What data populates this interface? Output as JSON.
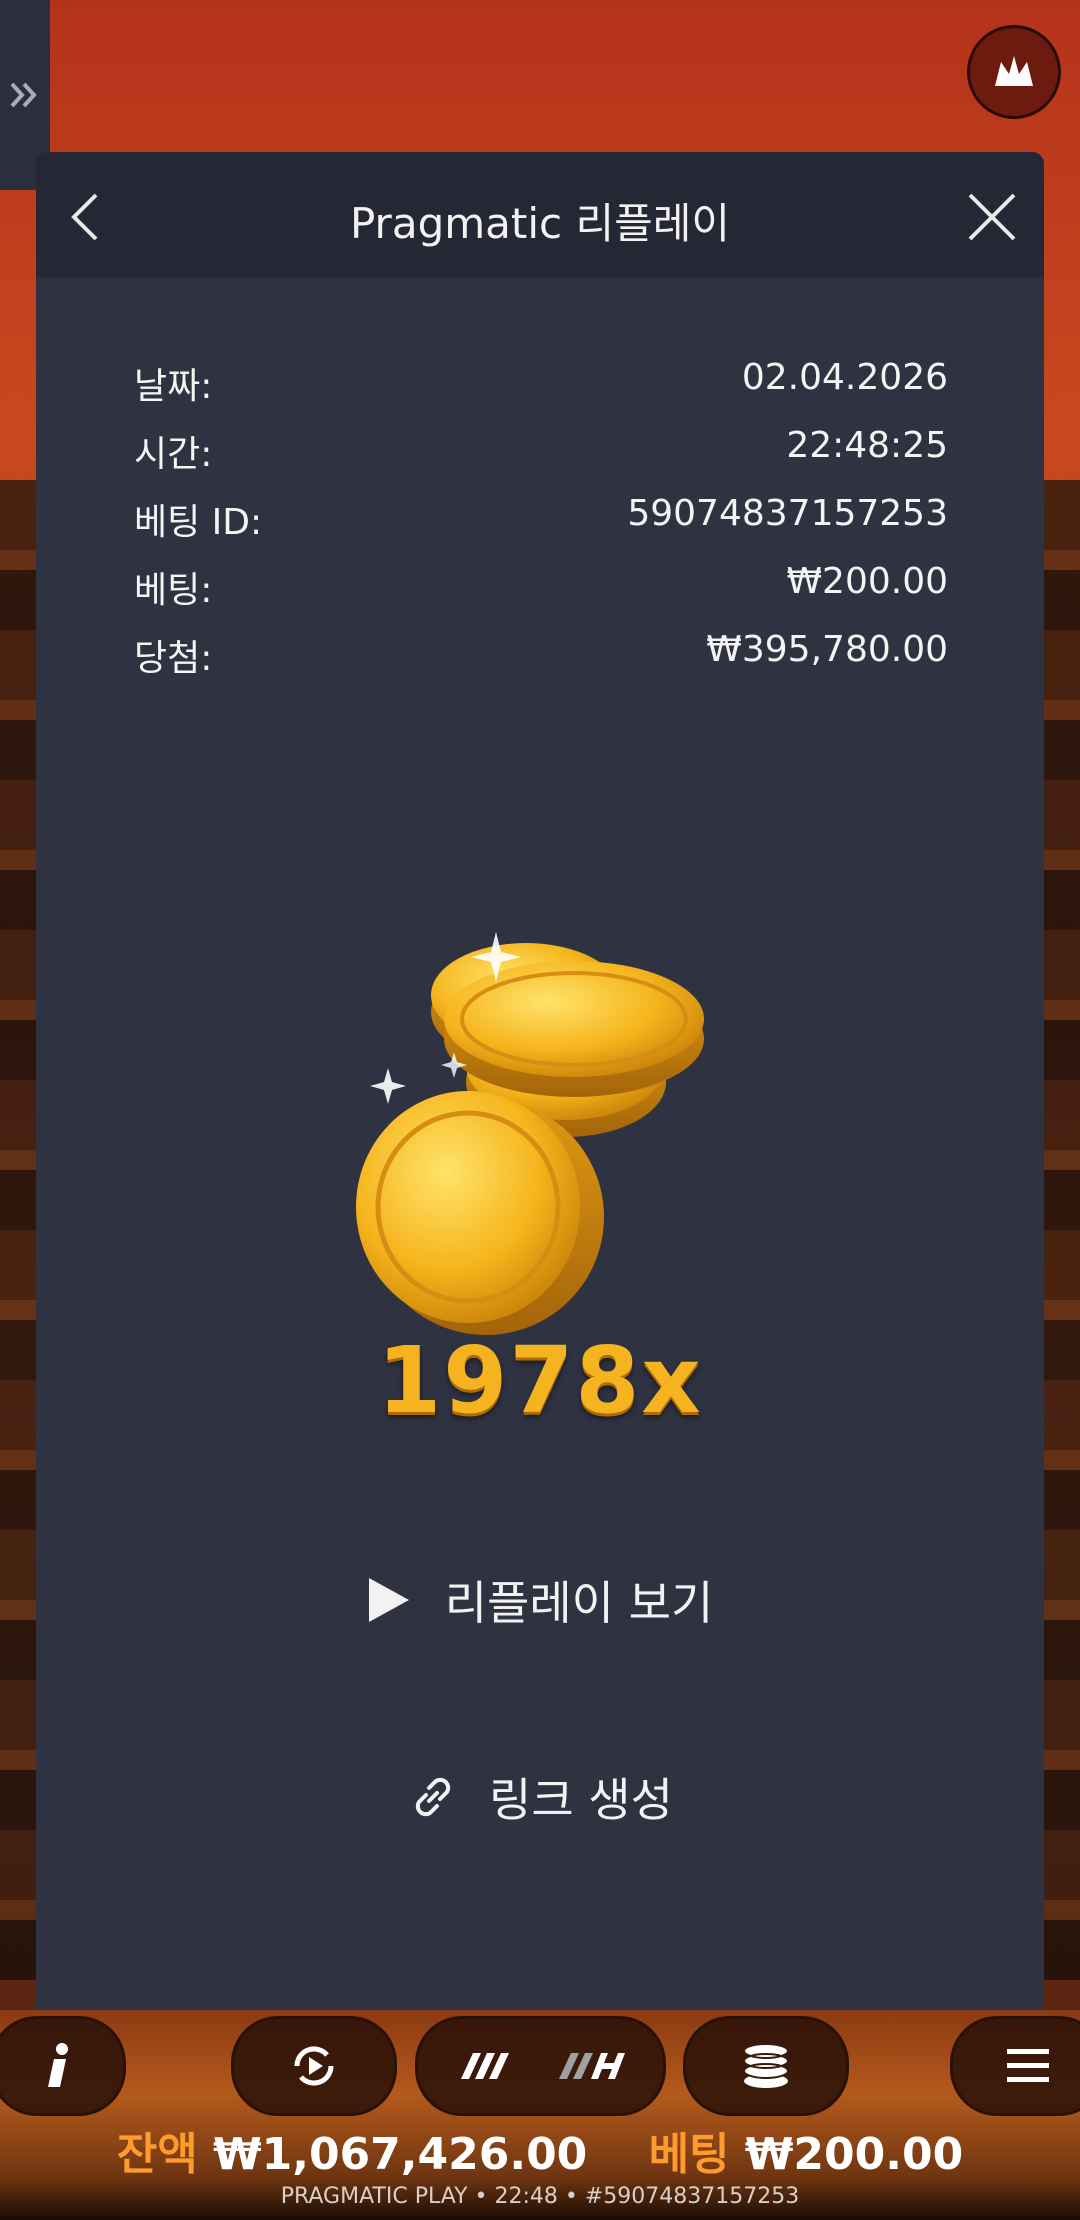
{
  "header": {
    "title": "Pragmatic 리플레이"
  },
  "details": {
    "rows": [
      {
        "label": "날짜:",
        "value": "02.04.2026"
      },
      {
        "label": "시간:",
        "value": "22:48:25"
      },
      {
        "label": "베팅 ID:",
        "value": "59074837157253"
      },
      {
        "label": "베팅:",
        "value": "₩200.00"
      },
      {
        "label": "당첨:",
        "value": "₩395,780.00"
      }
    ]
  },
  "win": {
    "multiplier": "1978x"
  },
  "actions": {
    "replay_label": "리플레이 보기",
    "link_label": "링크 생성"
  },
  "game_bar": {
    "balance_label": "잔액",
    "balance_value": "₩1,067,426.00",
    "bet_label": "베팅",
    "bet_value": "₩200.00",
    "footer": "PRAGMATIC PLAY • 22:48 • #59074837157253"
  },
  "colors": {
    "modal_bg": "#2f3240",
    "header_bg": "#252834",
    "multiplier_gold": "#f5b320",
    "balance_label": "#ff9b2e"
  },
  "icons": [
    "chevron-left-icon",
    "close-icon",
    "play-icon",
    "link-icon",
    "crown-icon",
    "double-chevron-right-icon",
    "info-icon",
    "autoplay-icon",
    "turbo-icon",
    "coins-icon",
    "menu-icon"
  ]
}
